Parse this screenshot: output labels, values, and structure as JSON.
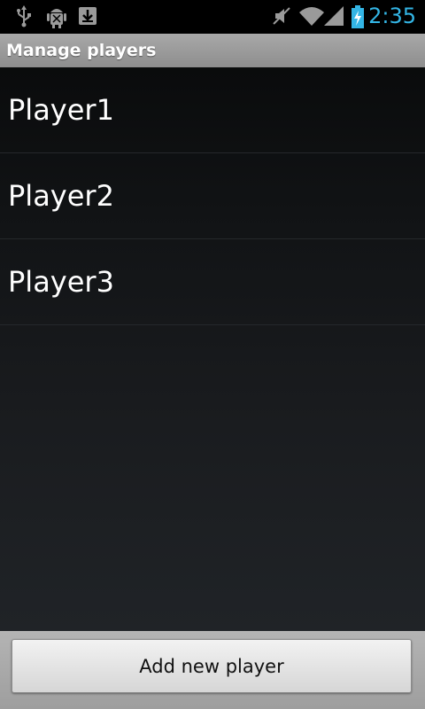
{
  "status_bar": {
    "time": "2:35",
    "icons": [
      "usb-icon",
      "android-debug-icon",
      "download-icon",
      "mute-icon",
      "wifi-icon",
      "signal-icon",
      "battery-charging-icon"
    ],
    "accent_color": "#33b5e5"
  },
  "title_bar": {
    "title": "Manage players"
  },
  "players": [
    {
      "name": "Player1"
    },
    {
      "name": "Player2"
    },
    {
      "name": "Player3"
    }
  ],
  "bottom_bar": {
    "add_label": "Add new player"
  }
}
